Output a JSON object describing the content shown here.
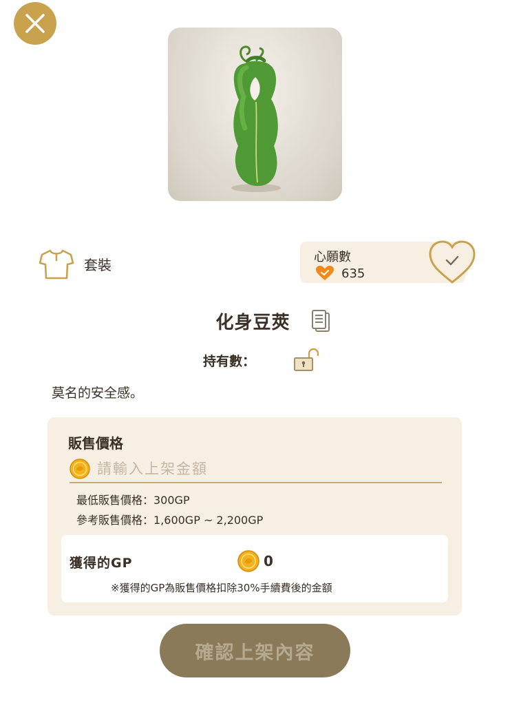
{
  "item": {
    "name": "化身豆莢",
    "category": "套裝",
    "description": "莫名的安全感。",
    "hold_label": "持有數："
  },
  "wishlist": {
    "title": "心願數",
    "count": "635"
  },
  "price": {
    "title": "販售價格",
    "placeholder": "請輸入上架金額",
    "min_price": "最低販售價格：300GP",
    "ref_price": "參考販售價格：1,600GP ~ 2,200GP"
  },
  "gp": {
    "label": "獲得的GP",
    "value": "0",
    "note": "※獲得的GP為販售價格扣除30%手續費後的金額"
  },
  "confirm_label": "確認上架內容",
  "colors": {
    "accent_gold": "#c9a24e",
    "panel_bg": "#f7efe2",
    "confirm_bg": "#8b7a5a",
    "heart_orange": "#f08a1c"
  }
}
